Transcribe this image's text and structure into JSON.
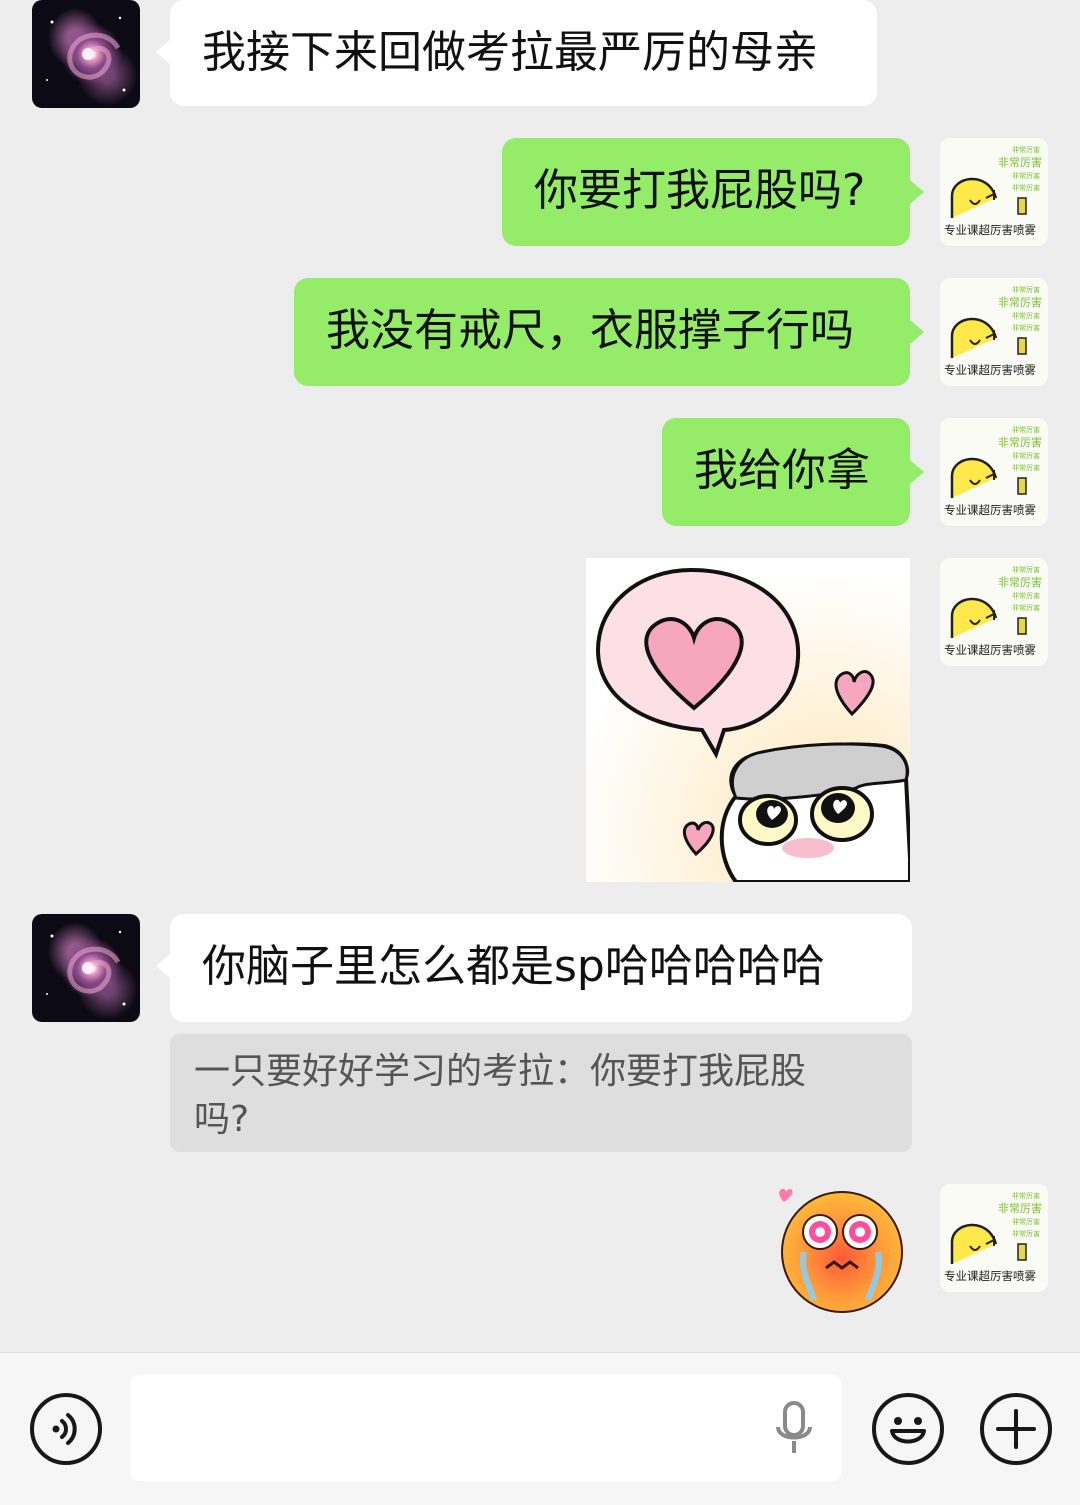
{
  "messages": [
    {
      "side": "in",
      "text": "我接下来回做考拉最严厉的母亲"
    },
    {
      "side": "out",
      "text": "你要打我屁股吗?"
    },
    {
      "side": "out",
      "text": "我没有戒尺，衣服撑子行吗"
    },
    {
      "side": "out",
      "text": "我给你拿"
    },
    {
      "side": "out",
      "sticker": "heart-cat-sticker"
    },
    {
      "side": "in",
      "text": "你脑子里怎么都是sp哈哈哈哈哈",
      "quote": "一只要好好学习的考拉：你要打我屁股吗?"
    },
    {
      "side": "out",
      "sticker": "blushing-face-sticker"
    }
  ],
  "my_avatar": {
    "caption": "专业课超厉害喷雾",
    "tags": [
      "非常厉害",
      "非常厉害",
      "非常厉害",
      "非常厉害"
    ]
  },
  "input": {
    "placeholder": "",
    "value": ""
  },
  "icons": {
    "voice": "voice-mode-icon",
    "mic": "microphone-icon",
    "emoji": "emoji-icon",
    "plus": "plus-icon"
  },
  "colors": {
    "background": "#ededed",
    "outgoing_bubble": "#95ec69",
    "incoming_bubble": "#ffffff",
    "quote_bg": "#dedede"
  }
}
